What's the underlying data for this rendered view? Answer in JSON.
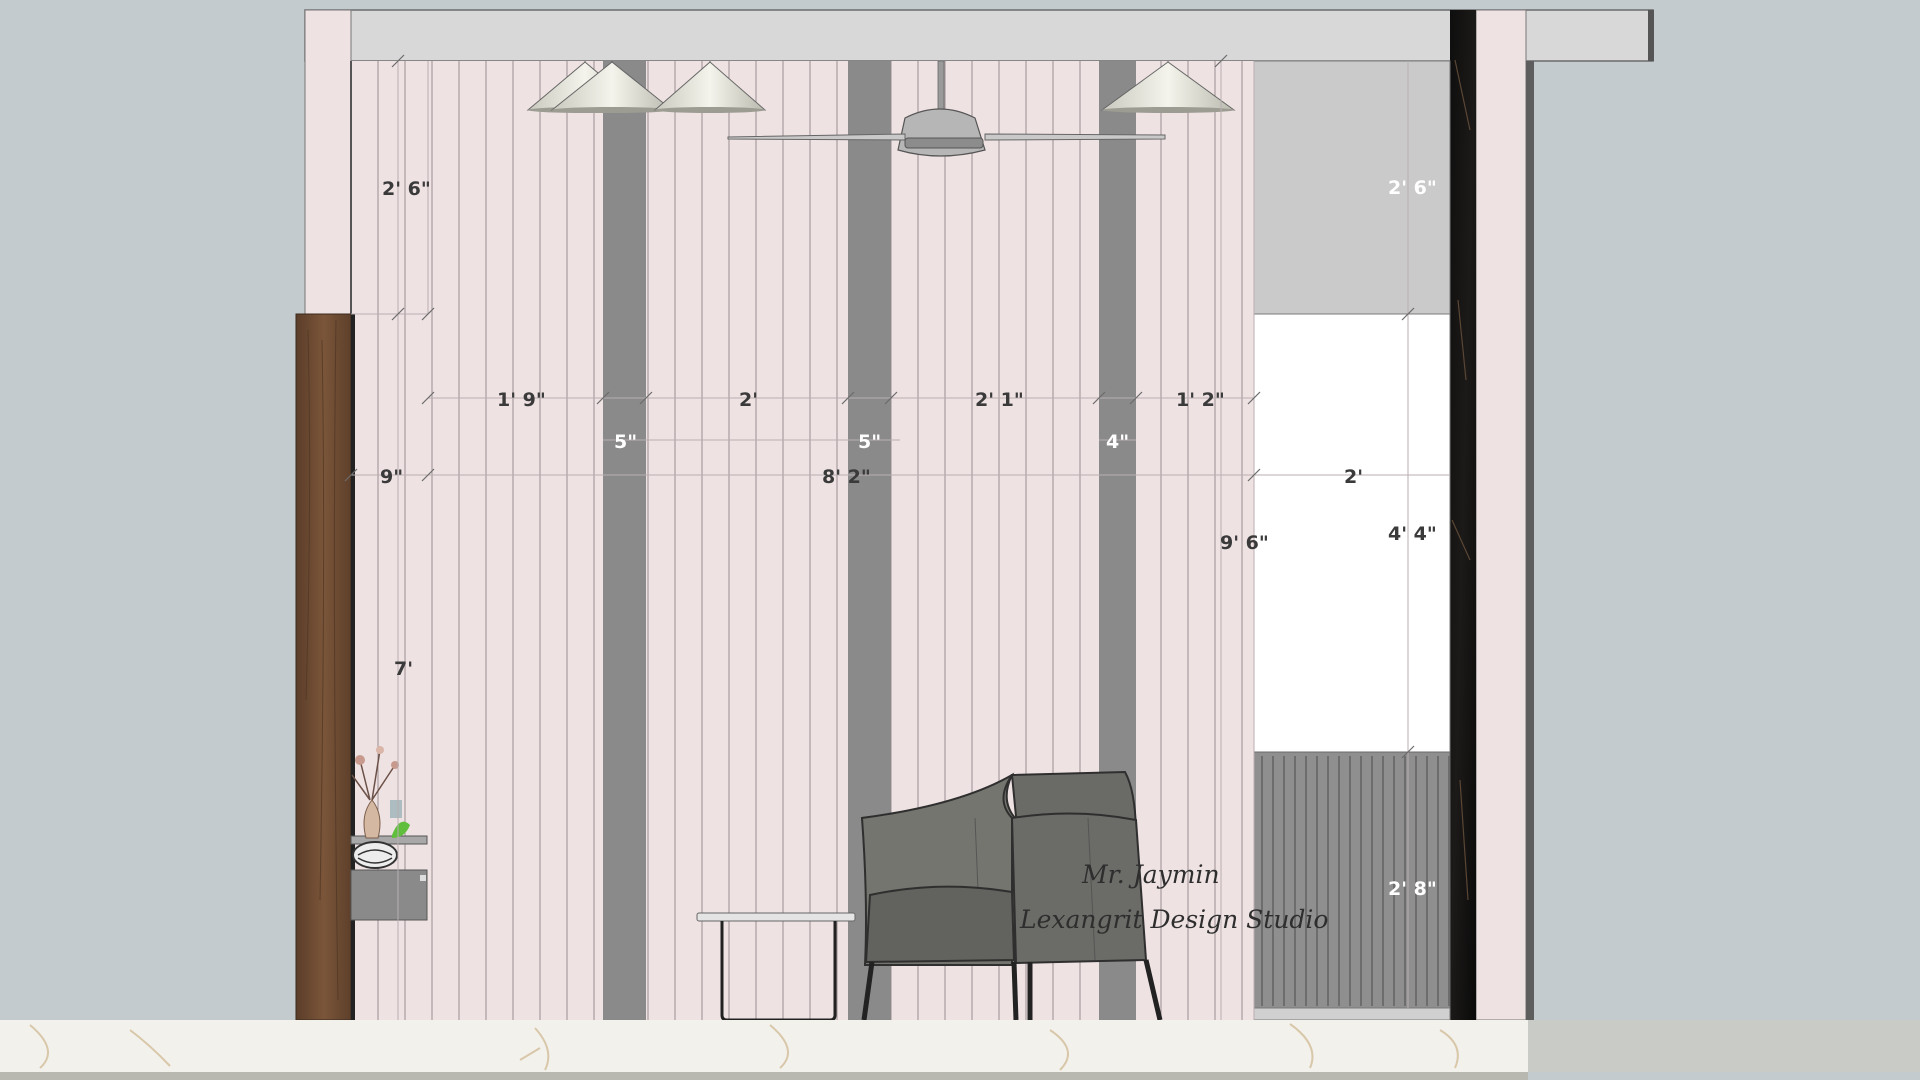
{
  "drawing": {
    "view": "interior wall elevation",
    "colors": {
      "background": "#c4cbce",
      "wall_panel": "#efe2e3",
      "groove": "#8a8a8a",
      "ceiling_band": "#d6d6d6",
      "wood": "#6b4a34",
      "marble_floor": "#f3f1ec",
      "black_marble": "#141414",
      "window_frame": "#cfcfcf"
    },
    "dimensions": {
      "top_left_height": "2' 6\"",
      "top_right_height": "2' 6\"",
      "panel_1_width": "1' 9\"",
      "panel_2_width": "2'",
      "panel_3_width": "2' 1\"",
      "panel_4_width": "1' 2\"",
      "groove_1_width": "5\"",
      "groove_2_width": "5\"",
      "groove_3_width": "4\"",
      "left_strip_width": "9\"",
      "overall_wall_width": "8' 2\"",
      "window_width": "2'",
      "wall_height": "9' 6\"",
      "window_height": "4' 4\"",
      "left_lower_height": "7'",
      "bottom_right_height": "2' 8\""
    },
    "signature": {
      "line1": "Mr. Jaymin",
      "line2": "Lexangrit Design Studio"
    },
    "icons": [
      "pendant-lamp-icon",
      "ceiling-fan-icon",
      "lounge-chair-icon",
      "side-table-icon",
      "flower-vase-icon"
    ]
  }
}
